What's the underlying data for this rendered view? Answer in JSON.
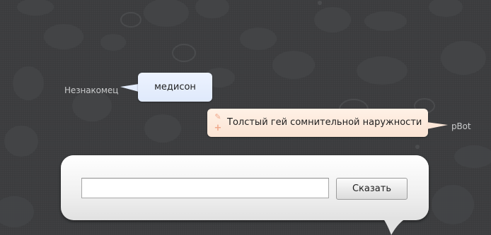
{
  "messages": [
    {
      "speaker": "Незнакомец",
      "text": "медисон",
      "side": "left"
    },
    {
      "speaker": "pBot",
      "text": "Толстый гей сомнительной наружности",
      "side": "right",
      "icons": [
        "pencil-icon",
        "plus-icon"
      ]
    }
  ],
  "composer": {
    "input_value": "",
    "input_placeholder": "",
    "send_label": "Сказать"
  },
  "colors": {
    "background": "#3a3b3d",
    "user_bubble": "#e3ecfc",
    "bot_bubble": "#fbe6d7",
    "accent_icon": "#f0a98c"
  }
}
